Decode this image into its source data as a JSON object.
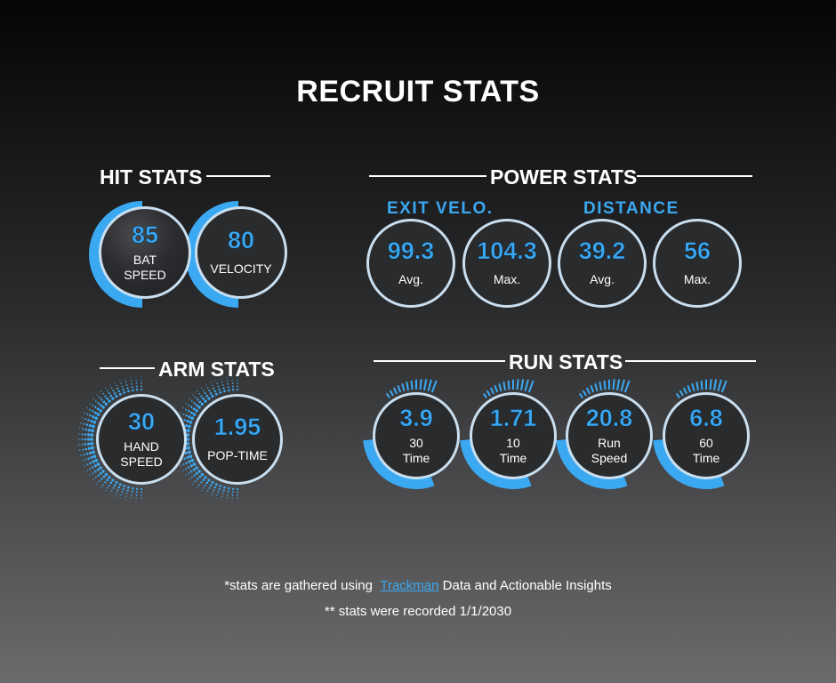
{
  "title": "RECRUIT STATS",
  "hit": {
    "title": "HIT STATS",
    "items": [
      {
        "value": "85",
        "label": "BAT\nSPEED"
      },
      {
        "value": "80",
        "label": "VELOCITY"
      }
    ]
  },
  "power": {
    "title": "POWER STATS",
    "exit_title": "EXIT VELO.",
    "distance_title": "DISTANCE",
    "items": [
      {
        "value": "99.3",
        "label": "Avg."
      },
      {
        "value": "104.3",
        "label": "Max."
      },
      {
        "value": "39.2",
        "label": "Avg."
      },
      {
        "value": "56",
        "label": "Max."
      }
    ]
  },
  "arm": {
    "title": "ARM STATS",
    "items": [
      {
        "value": "30",
        "label": "HAND\nSPEED"
      },
      {
        "value": "1.95",
        "label": "POP-TIME"
      }
    ]
  },
  "run": {
    "title": "RUN STATS",
    "items": [
      {
        "value": "3.9",
        "label": "30\nTime"
      },
      {
        "value": "1.71",
        "label": "10\nTime"
      },
      {
        "value": "20.8",
        "label": "Run\nSpeed"
      },
      {
        "value": "6.8",
        "label": "60\nTime"
      }
    ]
  },
  "footer": {
    "line1_prefix": "*stats are gathered using",
    "line1_link": "Trackman",
    "line1_suffix": "Data and Actionable Insights",
    "line2": "** stats were recorded 1/1/2030"
  },
  "colors": {
    "accent": "#3ba8f2",
    "ring": "#c9dff0",
    "circle_fill": "#2a2b2d"
  }
}
